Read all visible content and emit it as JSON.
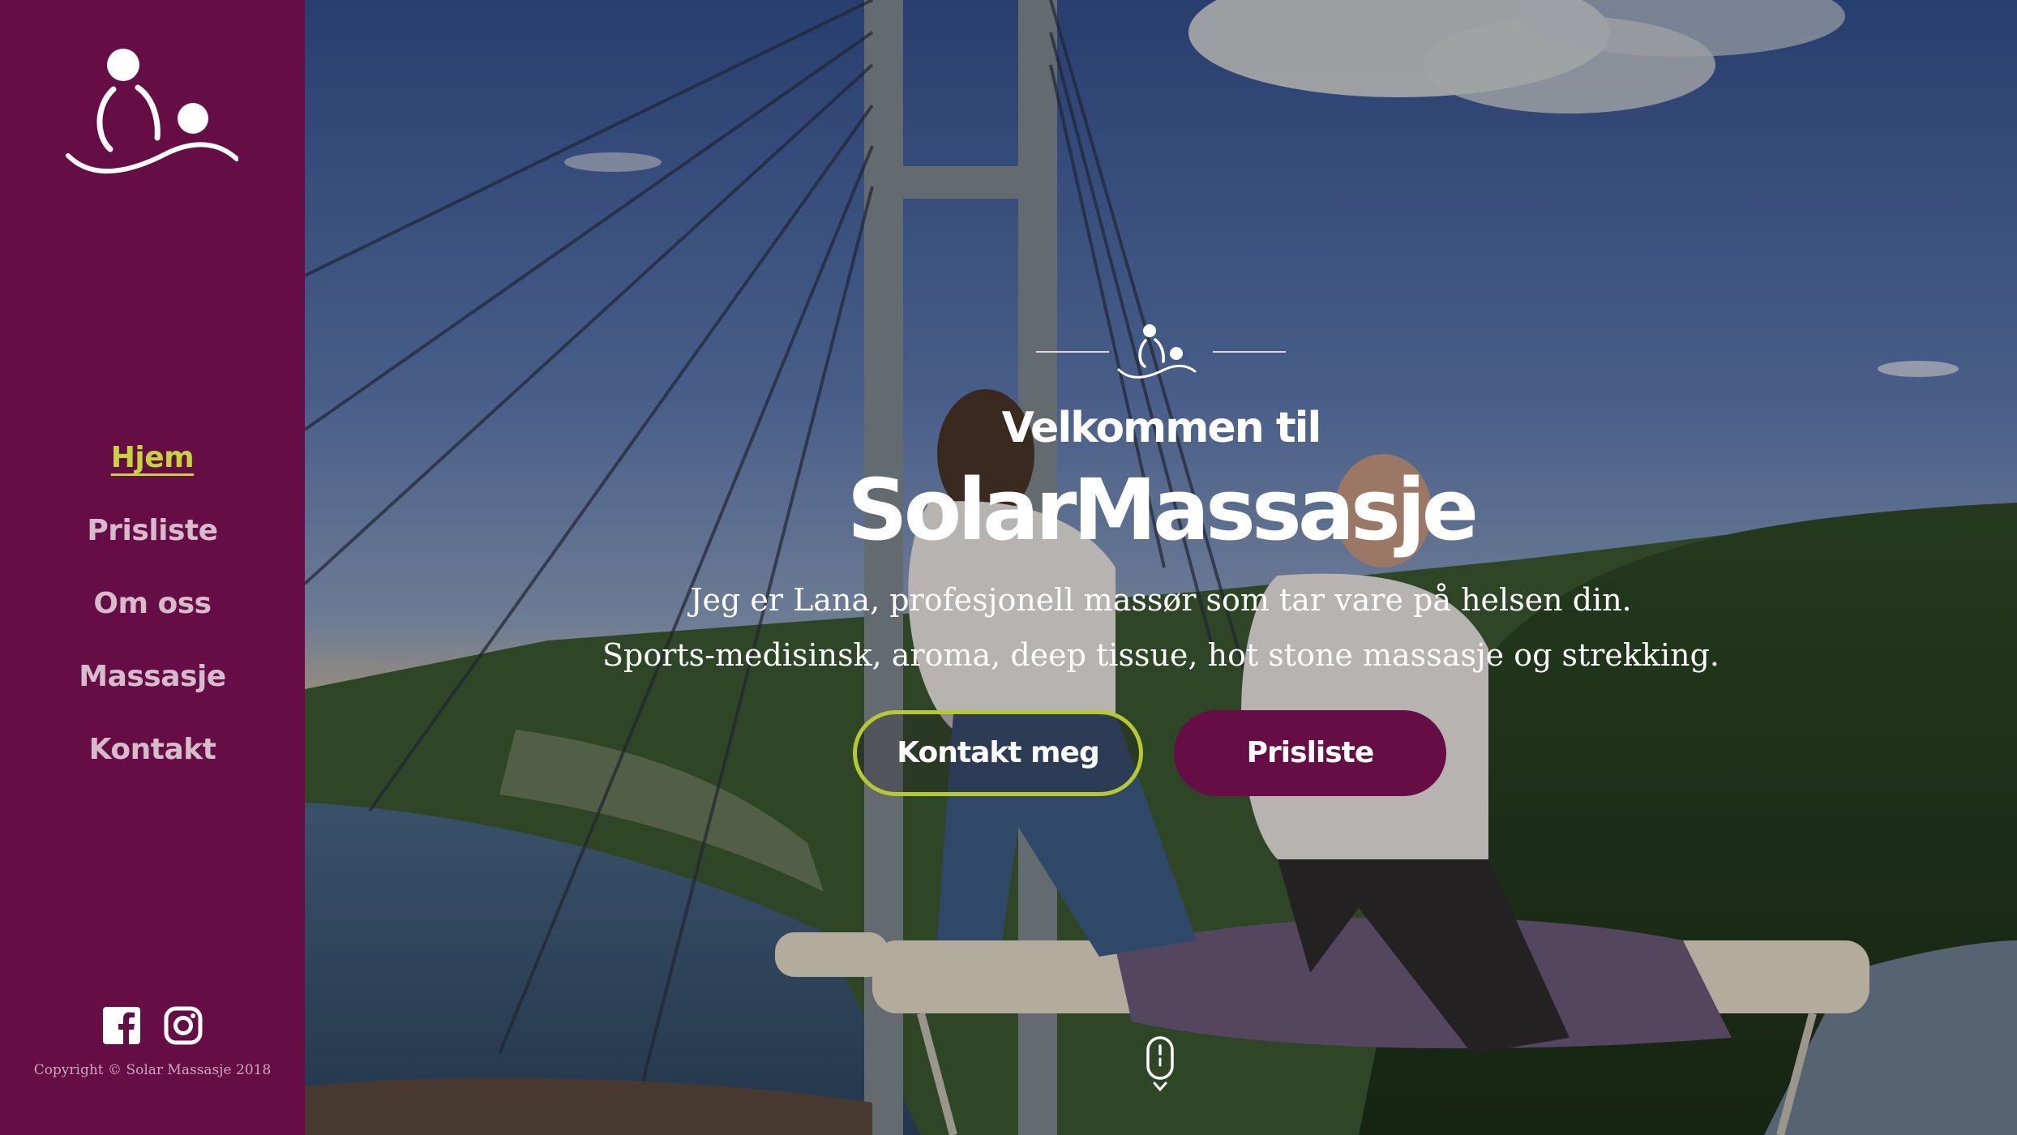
{
  "sidebar": {
    "nav": [
      {
        "label": "Hjem",
        "active": true
      },
      {
        "label": "Prisliste",
        "active": false
      },
      {
        "label": "Om oss",
        "active": false
      },
      {
        "label": "Massasje",
        "active": false
      },
      {
        "label": "Kontakt",
        "active": false
      }
    ],
    "social": [
      "facebook-icon",
      "instagram-icon"
    ],
    "copyright": "Copyright © Solar Massasje 2018"
  },
  "hero": {
    "welcome": "Velkommen til",
    "brand": "SolarMassasje",
    "tagline_1": "Jeg er Lana, profesjonell massør som tar vare på helsen din.",
    "tagline_2": "Sports-medisinsk, aroma, deep tissue, hot stone massasje og strekking.",
    "buttons": {
      "contact": "Kontakt meg",
      "prices": "Prisliste"
    }
  },
  "colors": {
    "brand_purple": "#650d44",
    "accent_green": "#c5d33f",
    "nav_text": "#d6bccb"
  }
}
